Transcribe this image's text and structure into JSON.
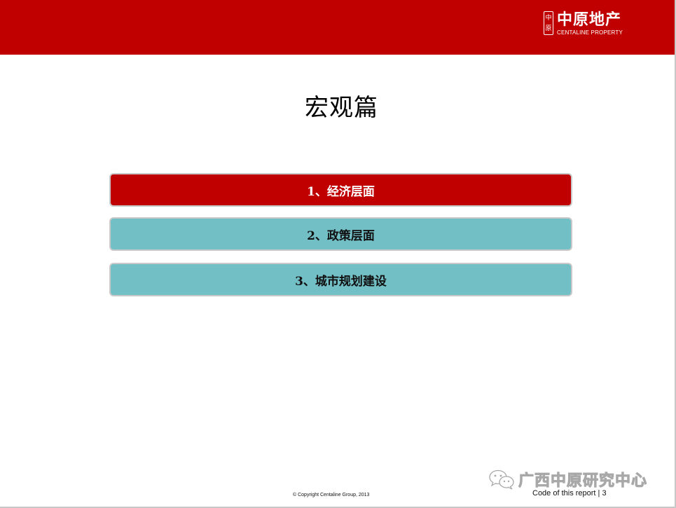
{
  "header": {
    "logo_seal_top": "中",
    "logo_seal_bottom": "原",
    "logo_cn": "中原地产",
    "logo_en": "CENTALINE PROPERTY",
    "band_color": "#c00000"
  },
  "main": {
    "title": "宏观篇",
    "items": [
      {
        "label": "1、经济层面",
        "color": "#c00000"
      },
      {
        "label": "2、政策层面",
        "color": "#72bfc6"
      },
      {
        "label": "3、城市规划建设",
        "color": "#72bfc6"
      }
    ]
  },
  "footer": {
    "copyright": "© Copyright  Centaline  Group,  2013",
    "report_code": "Code of this report    |    3",
    "watermark": "广西中原研究中心",
    "watermark_icon": "wechat-icon"
  }
}
